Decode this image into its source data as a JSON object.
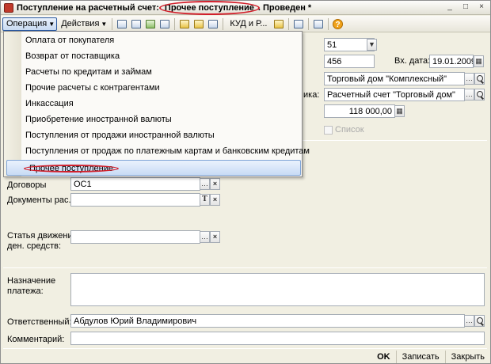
{
  "window": {
    "title_prefix": "Поступление на расчетный счет:",
    "title_highlight": "Прочее поступление",
    "title_suffix": ". Проведен *",
    "controls": [
      "_",
      "□",
      "×"
    ]
  },
  "toolbar": {
    "operation_label": "Операция",
    "actions_label": "Действия",
    "kud_label": "КУД и Р..."
  },
  "operation_menu": {
    "items": [
      "Оплата от покупателя",
      "Возврат от поставщика",
      "Расчеты по кредитам и займам",
      "Прочие расчеты с контрагентами",
      "Инкассация",
      "Приобретение иностранной валюты",
      "Поступления от продажи иностранной валюты",
      "Поступления от продаж по платежным картам и банковским кредитам"
    ],
    "selected": "Прочее поступление"
  },
  "form": {
    "account_value": "51",
    "in_number_value": "456",
    "in_date_label": "Вх. дата:",
    "in_date_value": "19.01.2009",
    "organization_value": "Торговый дом \"Комплексный\"",
    "bank_account_label_tail": "ика:",
    "bank_account_value": "Расчетный счет \"Торговый дом\"",
    "amount_value": "118 000,00",
    "list_checkbox_label": "Список",
    "contracts_label": "Договоры",
    "contracts_value": "ОС1",
    "documents_label": "Документы рас...",
    "documents_value": "",
    "cash_flow_label_line1": "Статья движения",
    "cash_flow_label_line2": "ден. средств:",
    "cash_flow_value": "",
    "purpose_label_line1": "Назначение",
    "purpose_label_line2": "платежа:",
    "responsible_label": "Ответственный:",
    "responsible_value": "Абдулов Юрий Владимирович",
    "comment_label": "Комментарий:",
    "comment_value": ""
  },
  "bottom": {
    "ok_label": "OK",
    "save_label": "Записать",
    "close_label": "Закрыть"
  },
  "colors": {
    "highlight_circle": "#d21f2b",
    "window_bg": "#f1efe2",
    "menu_selected_bg": "#c8dbf5"
  }
}
